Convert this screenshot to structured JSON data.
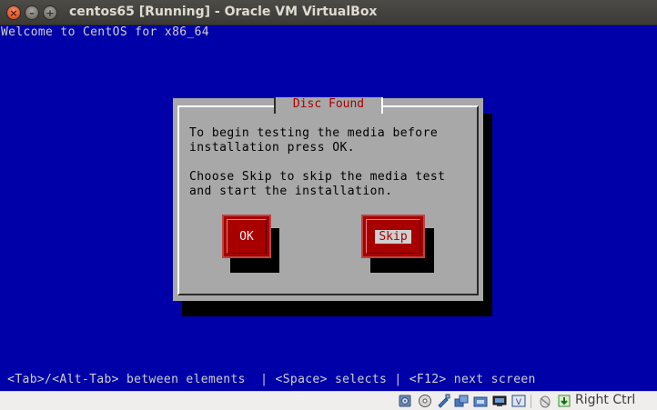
{
  "window": {
    "title": "centos65 [Running] - Oracle VM VirtualBox",
    "close_glyph": "×",
    "minimize_glyph": "–",
    "maximize_glyph": "+"
  },
  "screen": {
    "background_color": "#0000a8",
    "welcome_text": "Welcome to CentOS for x86_64",
    "dialog": {
      "title": "Disc Found",
      "message_line1": "To begin testing the media before",
      "message_line2": "installation press OK.",
      "message_line3": "Choose Skip to skip the media test",
      "message_line4": "and start the installation.",
      "ok_label": "OK",
      "skip_label": "Skip",
      "focused_button": "Skip"
    },
    "hint_bar": " <Tab>/<Alt-Tab> between elements  | <Space> selects | <F12> next screen"
  },
  "statusbar": {
    "icons": [
      "hard-disk-icon",
      "optical-drive-icon",
      "usb-icon",
      "shared-folders-icon",
      "network-icon",
      "display-icon",
      "video-capture-icon",
      "mouse-integration-icon",
      "keyboard-capture-icon"
    ],
    "host_key": "Right Ctrl"
  }
}
